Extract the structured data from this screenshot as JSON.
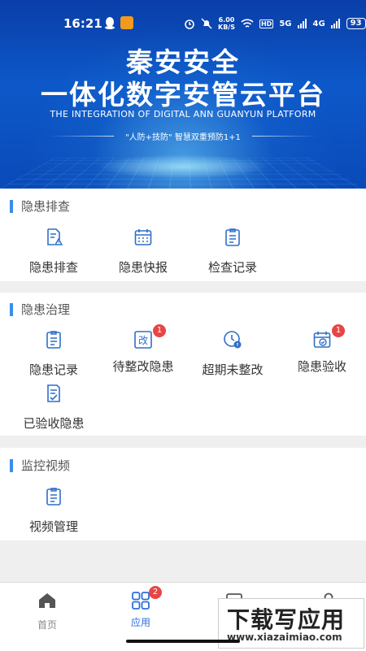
{
  "status_bar": {
    "time": "16:21",
    "network_speed": "6.00",
    "speed_unit": "KB/S",
    "hd": "HD",
    "signal1": "5G",
    "signal2": "4G",
    "battery": "93"
  },
  "banner": {
    "title_line1": "秦安安全",
    "title_line2": "一体化数字安管云平台",
    "subtitle": "THE INTEGRATION OF DIGITAL ANN GUANYUN PLATFORM",
    "slogan": "\"人防+技防\" 智慧双重预防1+1"
  },
  "sections": [
    {
      "title": "隐患排查",
      "items": [
        {
          "label": "隐患排查",
          "icon": "doc-warning-icon"
        },
        {
          "label": "隐患快报",
          "icon": "calendar-icon"
        },
        {
          "label": "检查记录",
          "icon": "clipboard-icon"
        }
      ]
    },
    {
      "title": "隐患治理",
      "items": [
        {
          "label": "隐患记录",
          "icon": "clipboard-icon"
        },
        {
          "label": "待整改隐患",
          "icon": "rectify-icon",
          "badge": "1"
        },
        {
          "label": "超期未整改",
          "icon": "clock-alert-icon"
        },
        {
          "label": "隐患验收",
          "icon": "calendar-check-icon",
          "badge": "1"
        },
        {
          "label": "已验收隐患",
          "icon": "doc-check-icon"
        }
      ]
    },
    {
      "title": "监控视频",
      "items": [
        {
          "label": "视频管理",
          "icon": "clipboard-icon"
        }
      ]
    }
  ],
  "bottom_nav": {
    "tabs": [
      {
        "label": "首页",
        "icon": "home-icon"
      },
      {
        "label": "应用",
        "icon": "apps-grid-icon",
        "badge": "2",
        "active": true
      }
    ]
  },
  "watermark": {
    "line1": "下载写应用",
    "line2": "www.xiazaimiao.com"
  },
  "colors": {
    "accent": "#3a8ee8",
    "active_tab": "#2c6fd8",
    "badge": "#e84545",
    "banner": "#0d58c9"
  }
}
